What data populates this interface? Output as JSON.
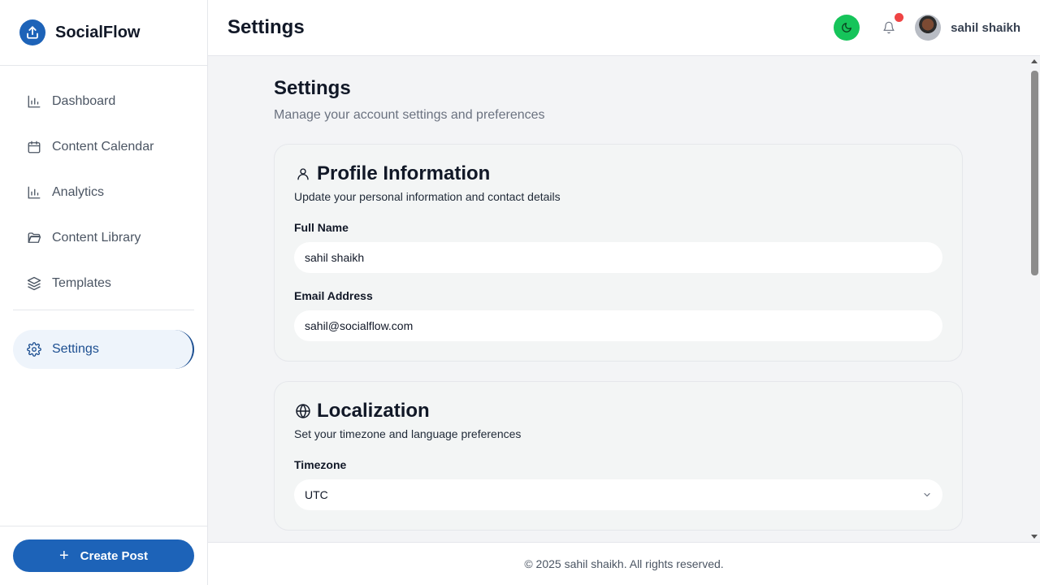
{
  "brand": {
    "name": "SocialFlow",
    "icon": "upload-icon",
    "color": "#1d63b8"
  },
  "sidebar": {
    "items": [
      {
        "label": "Dashboard",
        "icon": "bar-chart-icon"
      },
      {
        "label": "Content Calendar",
        "icon": "calendar-icon"
      },
      {
        "label": "Analytics",
        "icon": "bar-chart-icon"
      },
      {
        "label": "Content Library",
        "icon": "folder-icon"
      },
      {
        "label": "Templates",
        "icon": "layers-icon"
      },
      {
        "label": "Settings",
        "icon": "gear-icon",
        "active": true
      }
    ],
    "create_label": "Create Post"
  },
  "header": {
    "title": "Settings",
    "user_name": "sahil shaikh",
    "theme_color": "#16c45a",
    "notification_dot_color": "#ef4444"
  },
  "main": {
    "title": "Settings",
    "subtitle": "Manage your account settings and preferences",
    "profile": {
      "title": "Profile Information",
      "icon": "user-icon",
      "description": "Update your personal information and contact details",
      "full_name_label": "Full Name",
      "full_name_value": "sahil shaikh",
      "email_label": "Email Address",
      "email_value": "sahil@socialflow.com"
    },
    "localization": {
      "title": "Localization",
      "icon": "globe-icon",
      "description": "Set your timezone and language preferences",
      "timezone_label": "Timezone",
      "timezone_value": "UTC"
    }
  },
  "footer": {
    "text": "© 2025 sahil shaikh. All rights reserved."
  }
}
